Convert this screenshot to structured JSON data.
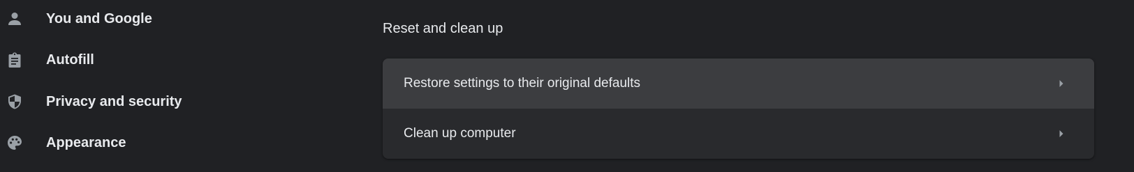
{
  "sidebar": {
    "items": [
      {
        "label": "You and Google",
        "icon": "person-icon"
      },
      {
        "label": "Autofill",
        "icon": "clipboard-icon"
      },
      {
        "label": "Privacy and security",
        "icon": "shield-icon"
      },
      {
        "label": "Appearance",
        "icon": "palette-icon"
      }
    ]
  },
  "main": {
    "section_title": "Reset and clean up",
    "rows": [
      {
        "label": "Restore settings to their original defaults"
      },
      {
        "label": "Clean up computer"
      }
    ]
  },
  "colors": {
    "background": "#202124",
    "card": "#292a2d",
    "row_hover": "#3c3d40",
    "text": "#e8eaed",
    "icon": "#9aa0a6"
  }
}
